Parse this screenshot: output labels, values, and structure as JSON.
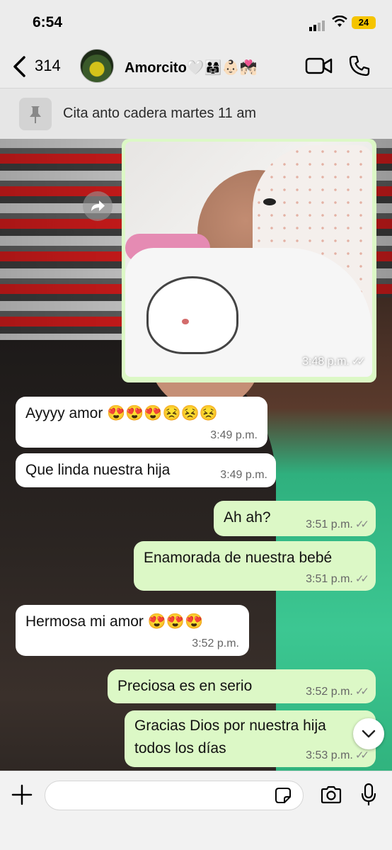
{
  "status_bar": {
    "time": "6:54",
    "battery": "24"
  },
  "header": {
    "back_count": "314",
    "contact_name": "Amorcito🤍👨‍👩‍👧👶🏻💏🏻"
  },
  "pinned": {
    "text": "Cita anto cadera martes 11 am"
  },
  "messages": [
    {
      "type": "image",
      "direction": "out",
      "time": "3:48 p.m.",
      "ticks": "✓✓"
    },
    {
      "direction": "in",
      "text": "Ayyyy amor 😍😍😍😣😣😣",
      "time": "3:49 p.m."
    },
    {
      "direction": "in",
      "text": "Que linda nuestra hija",
      "time": "3:49 p.m."
    },
    {
      "direction": "out",
      "text": "Ah ah?",
      "time": "3:51 p.m.",
      "ticks": "✓✓"
    },
    {
      "direction": "out",
      "text": "Enamorada de nuestra bebé",
      "time": "3:51 p.m.",
      "ticks": "✓✓"
    },
    {
      "direction": "in",
      "text": "Hermosa mi amor 😍😍😍",
      "time": "3:52 p.m."
    },
    {
      "direction": "out",
      "text": "Preciosa es en serio",
      "time": "3:52 p.m.",
      "ticks": "✓✓"
    },
    {
      "direction": "out",
      "text_line1": "Gracias Dios por nuestra hija",
      "text_line2": "todos los días",
      "time": "3:53 p.m.",
      "ticks": "✓✓"
    }
  ],
  "colors": {
    "outgoing_bubble": "#dcf8c6",
    "incoming_bubble": "#ffffff",
    "battery": "#f5c400"
  }
}
